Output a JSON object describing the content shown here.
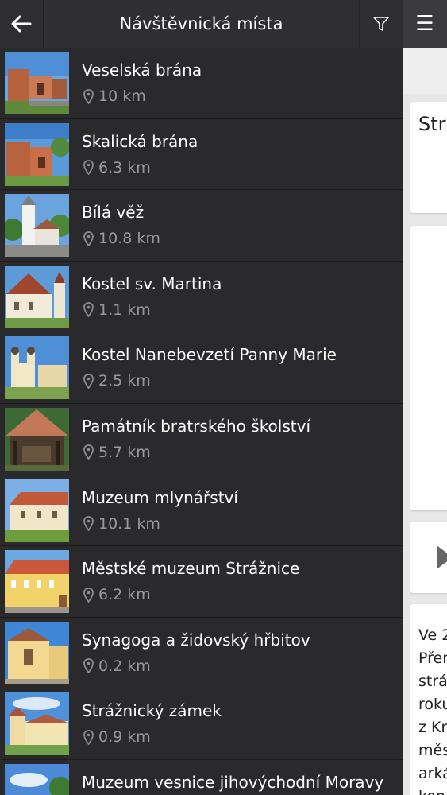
{
  "header": {
    "title": "Návštěvnická místa"
  },
  "places": [
    {
      "name": "Veselská brána",
      "distance": "10 km"
    },
    {
      "name": "Skalická brána",
      "distance": "6.3 km"
    },
    {
      "name": "Bílá věž",
      "distance": "10.8 km"
    },
    {
      "name": "Kostel sv. Martina",
      "distance": "1.1 km"
    },
    {
      "name": "Kostel Nanebevzetí Panny Marie",
      "distance": "2.5 km"
    },
    {
      "name": "Památník bratrského školství",
      "distance": "5.7 km"
    },
    {
      "name": "Muzeum mlynářství",
      "distance": "10.1 km"
    },
    {
      "name": "Městské muzeum Strážnice",
      "distance": "6.2 km"
    },
    {
      "name": "Synagoga a židovský hřbitov",
      "distance": "0.2 km"
    },
    {
      "name": "Strážnický zámek",
      "distance": "0.9 km"
    },
    {
      "name": "Muzeum vesnice jihovýchodní Moravy",
      "distance": ""
    }
  ],
  "background": {
    "heading_fragment": "Str",
    "text_fragments": [
      "Ve 2",
      "Přer",
      "strá",
      "roku",
      "z Kr",
      "měs",
      "arká",
      "kone"
    ]
  },
  "icons": {
    "back": "back-arrow-icon",
    "filter": "filter-icon",
    "menu": "hamburger-menu-icon",
    "location": "location-pin-icon",
    "play": "play-icon"
  },
  "colors": {
    "drawer_bg": "#2a2a2c",
    "topbar_bg": "#2f2f31",
    "distance_text": "#9a9a9a",
    "panel_bg": "#e7e7e7"
  }
}
